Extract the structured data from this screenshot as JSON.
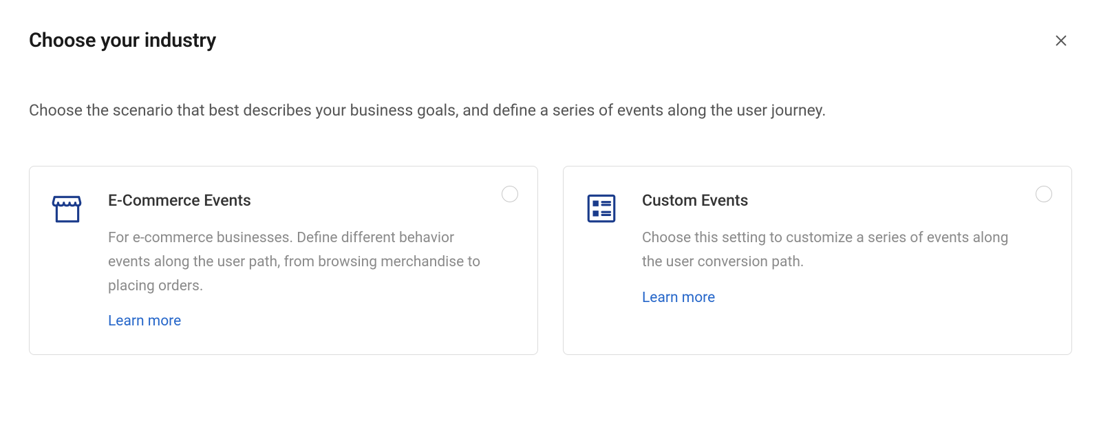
{
  "header": {
    "title": "Choose your industry"
  },
  "subtitle": "Choose the scenario that best describes your business goals, and define a series of events along the user journey.",
  "cards": [
    {
      "title": "E-Commerce Events",
      "desc": "For e-commerce businesses. Define different behavior events along the user path, from browsing merchandise to placing orders.",
      "link": "Learn more"
    },
    {
      "title": "Custom Events",
      "desc": "Choose this setting to customize a series of events along the user conversion path.",
      "link": "Learn more"
    }
  ]
}
